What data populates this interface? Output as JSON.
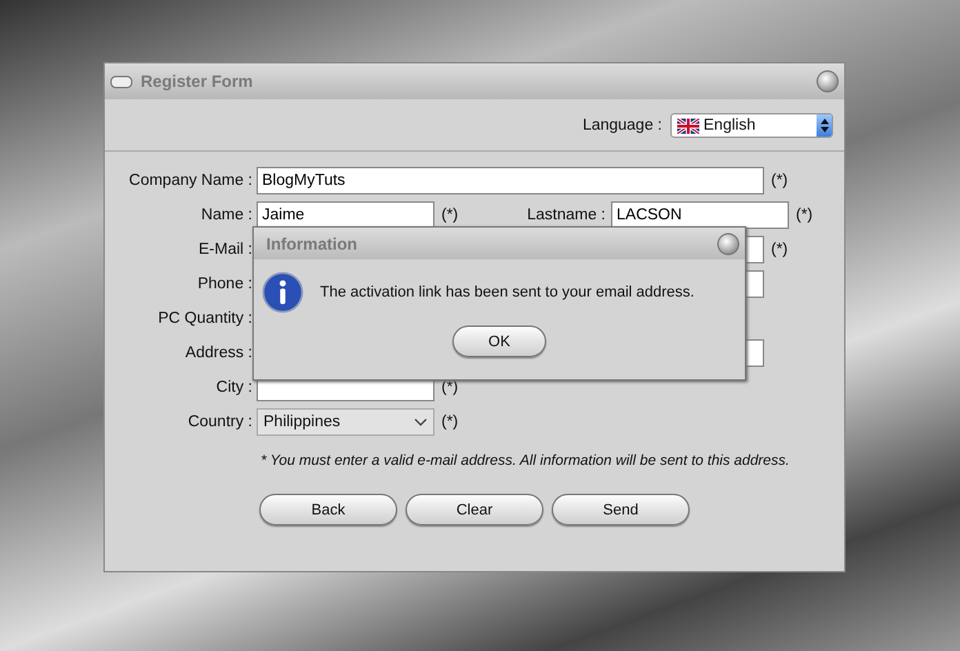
{
  "window": {
    "title": "Register Form"
  },
  "language": {
    "label": "Language :",
    "value": "English"
  },
  "rows": [
    {
      "kind": "wide",
      "label": "Company Name :",
      "value": "BlogMyTuts",
      "mark": "(*)"
    },
    {
      "kind": "pair",
      "label": "Name :",
      "value": "Jaime",
      "mark": "(*)",
      "label2": "Lastname :",
      "value2": "LACSON",
      "mark2": "(*)"
    },
    {
      "kind": "wide",
      "label": "E-Mail :",
      "value": "",
      "mark": "(*)"
    },
    {
      "kind": "wide",
      "label": "Phone :",
      "value": ""
    },
    {
      "kind": "label",
      "label": "PC Quantity :"
    },
    {
      "kind": "wide",
      "label": "Address :",
      "value": ""
    },
    {
      "kind": "short",
      "label": "City :",
      "value": "",
      "mark": "(*)"
    },
    {
      "kind": "select",
      "label": "Country :",
      "value": "Philippines",
      "mark": "(*)"
    }
  ],
  "note": "* You must enter a valid e-mail address. All information will be sent to this address.",
  "buttons": [
    "Back",
    "Clear",
    "Send"
  ],
  "dialog": {
    "title": "Information",
    "message": "The activation link has been sent to your email address.",
    "button": "OK"
  }
}
